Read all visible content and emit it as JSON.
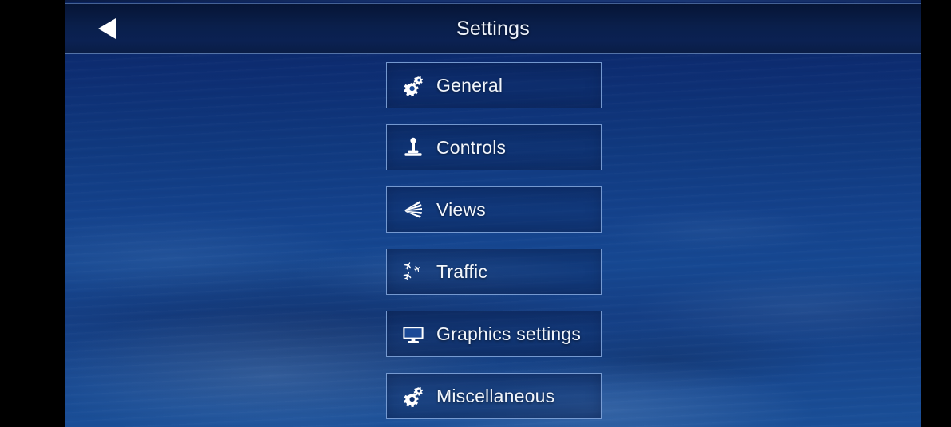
{
  "window": {
    "title": "Settings",
    "letterbox_color": "#000000",
    "accent_border_color": "#87ace2",
    "header_background": "#0a1f4b",
    "background_sky_color": "#14428c",
    "text_color": "#f2f6fc"
  },
  "header": {
    "title": "Settings",
    "back_button": {
      "label": "Back",
      "icon": "back-arrow-icon"
    }
  },
  "menu": {
    "items": [
      {
        "label": "General",
        "icon": "gears-icon"
      },
      {
        "label": "Controls",
        "icon": "joystick-icon"
      },
      {
        "label": "Views",
        "icon": "view-fan-icon"
      },
      {
        "label": "Traffic",
        "icon": "airplanes-icon"
      },
      {
        "label": "Graphics settings",
        "icon": "monitor-icon"
      },
      {
        "label": "Miscellaneous",
        "icon": "gears-icon"
      }
    ]
  }
}
